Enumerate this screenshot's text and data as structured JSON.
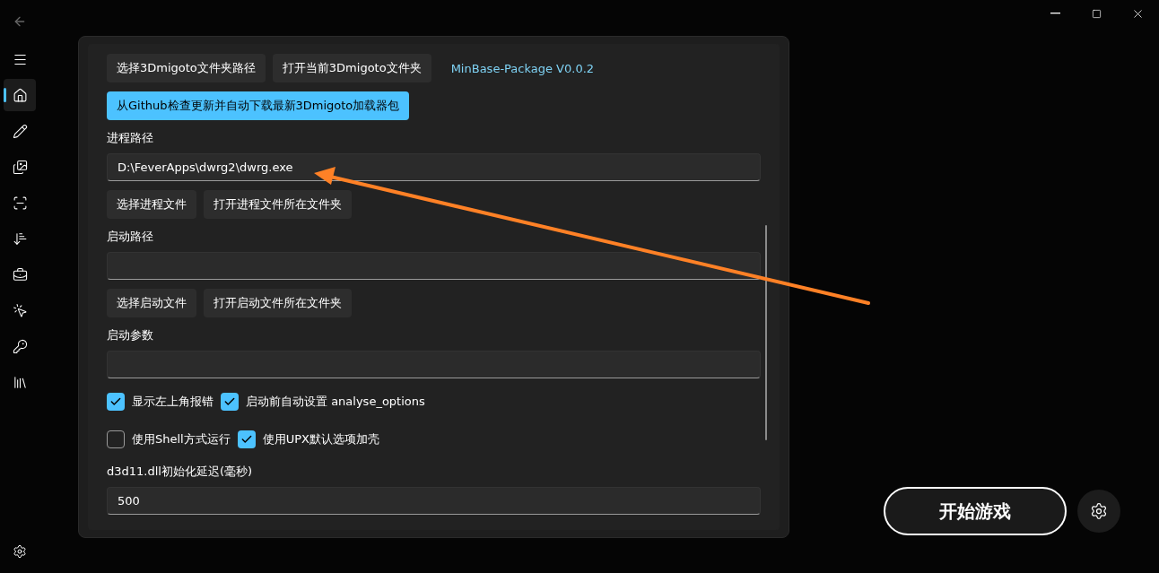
{
  "sidebar": {
    "items": [
      {
        "selected": false
      },
      {
        "selected": true
      },
      {
        "selected": false
      },
      {
        "selected": false
      },
      {
        "selected": false
      },
      {
        "selected": false
      },
      {
        "selected": false
      },
      {
        "selected": false
      },
      {
        "selected": false
      },
      {
        "selected": false
      }
    ]
  },
  "panel": {
    "sections": [
      {
        "kind": "buttons",
        "buttons": [
          {
            "label": "选择3Dmigoto文件夹路径",
            "primary": false
          },
          {
            "label": "打开当前3Dmigoto文件夹",
            "primary": false
          }
        ],
        "note": "MinBase-Package V0.0.2"
      },
      {
        "kind": "buttons",
        "buttons": [
          {
            "label": "从Github检查更新并自动下载最新3Dmigoto加载器包",
            "primary": true
          }
        ]
      },
      {
        "kind": "label",
        "text": "进程路径"
      },
      {
        "kind": "field",
        "value": "D:\\FeverApps\\dwrg2\\dwrg.exe"
      },
      {
        "kind": "buttons",
        "buttons": [
          {
            "label": "选择进程文件",
            "primary": false
          },
          {
            "label": "打开进程文件所在文件夹",
            "primary": false
          }
        ]
      },
      {
        "kind": "label",
        "text": "启动路径"
      },
      {
        "kind": "field"
      },
      {
        "kind": "buttons",
        "buttons": [
          {
            "label": "选择启动文件",
            "primary": false
          },
          {
            "label": "打开启动文件所在文件夹",
            "primary": false
          }
        ]
      },
      {
        "kind": "label",
        "text": "启动参数"
      },
      {
        "kind": "field"
      },
      {
        "kind": "checks",
        "checks": [
          {
            "label": "显示左上角报错",
            "checked": true
          },
          {
            "label": "启动前自动设置 analyse_options",
            "checked": true
          }
        ]
      },
      {
        "kind": "checks",
        "checks": [
          {
            "label": "使用Shell方式运行",
            "checked": false
          },
          {
            "label": "使用UPX默认选项加壳",
            "checked": true
          }
        ]
      },
      {
        "kind": "label",
        "text": "d3d11.dll初始化延迟(毫秒)"
      },
      {
        "kind": "field",
        "value": "500"
      }
    ]
  },
  "start_button": {
    "label": "开始游戏"
  }
}
